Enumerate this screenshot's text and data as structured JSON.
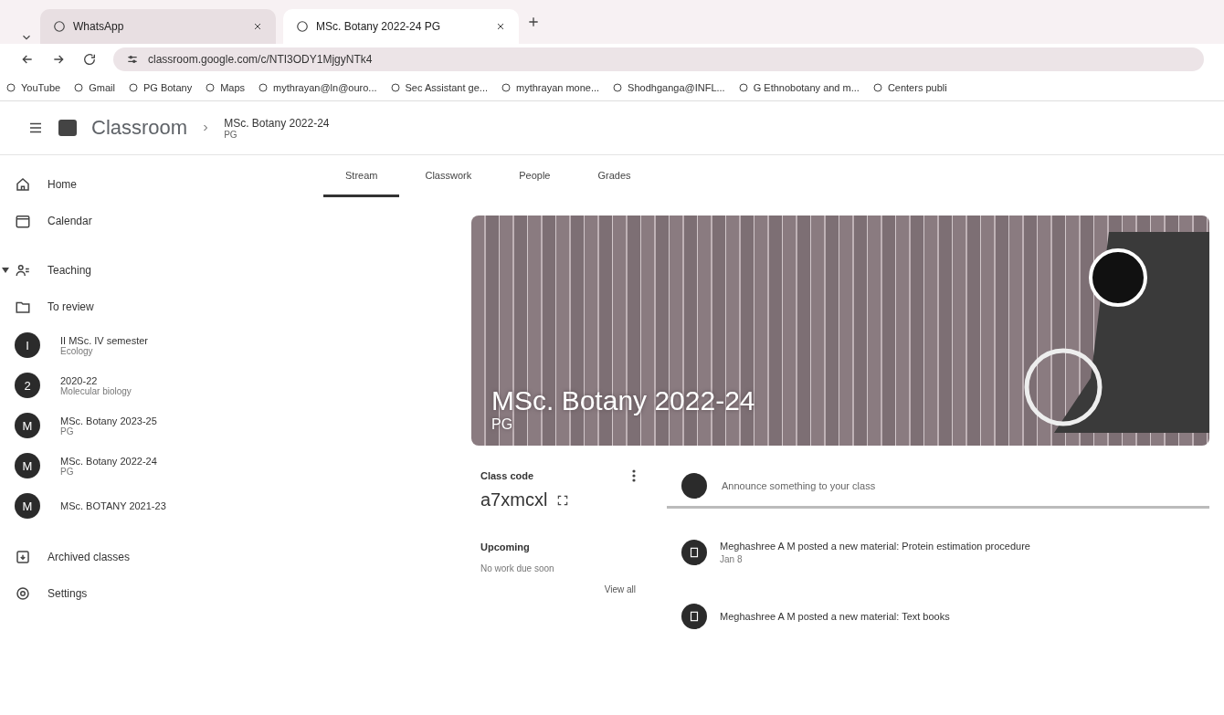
{
  "browser": {
    "tabs": [
      {
        "title": "WhatsApp",
        "selected": false
      },
      {
        "title": "MSc. Botany 2022-24 PG",
        "selected": true
      }
    ],
    "url": "classroom.google.com/c/NTI3ODY1MjgyNTk4",
    "bookmarks": [
      "YouTube",
      "Gmail",
      "PG Botany",
      "Maps",
      "mythrayan@ln@ouro...",
      "Sec Assistant ge...",
      "mythrayan mone...",
      "Shodhganga@INFL...",
      "G Ethnobotany and m...",
      "Centers publi"
    ]
  },
  "header": {
    "app": "Classroom",
    "class_title": "MSc. Botany 2022-24",
    "class_subtitle": "PG"
  },
  "sidebar": {
    "items": [
      {
        "kind": "home",
        "label": "Home"
      },
      {
        "kind": "calendar",
        "label": "Calendar"
      },
      {
        "kind": "teaching",
        "label": "Teaching",
        "expanded": true
      },
      {
        "kind": "review",
        "label": "To review"
      },
      {
        "kind": "class",
        "avatar": "I",
        "label": "II MSc. IV semester",
        "sub": "Ecology"
      },
      {
        "kind": "class",
        "avatar": "2",
        "label": "2020-22",
        "sub": "Molecular biology"
      },
      {
        "kind": "class",
        "avatar": "M",
        "label": "MSc. Botany 2023-25",
        "sub": "PG"
      },
      {
        "kind": "class",
        "avatar": "M",
        "label": "MSc. Botany 2022-24",
        "sub": "PG"
      },
      {
        "kind": "class",
        "avatar": "M",
        "label": "MSc. BOTANY 2021-23"
      },
      {
        "kind": "archive",
        "label": "Archived classes"
      },
      {
        "kind": "settings",
        "label": "Settings"
      }
    ]
  },
  "tabs": [
    {
      "label": "Stream",
      "selected": true
    },
    {
      "label": "Classwork",
      "selected": false
    },
    {
      "label": "People",
      "selected": false
    },
    {
      "label": "Grades",
      "selected": false
    }
  ],
  "banner": {
    "title": "MSc. Botany 2022-24",
    "subtitle": "PG"
  },
  "class_code": {
    "label": "Class code",
    "code": "a7xmcxl"
  },
  "upcoming": {
    "title": "Upcoming",
    "text": "No work due soon",
    "link": "View all"
  },
  "announce": {
    "placeholder": "Announce something to your class"
  },
  "posts": [
    {
      "text": "Meghashree A M posted a new material: Protein estimation procedure",
      "date": "Jan 8"
    },
    {
      "text": "Meghashree A M posted a new material: Text books"
    }
  ]
}
